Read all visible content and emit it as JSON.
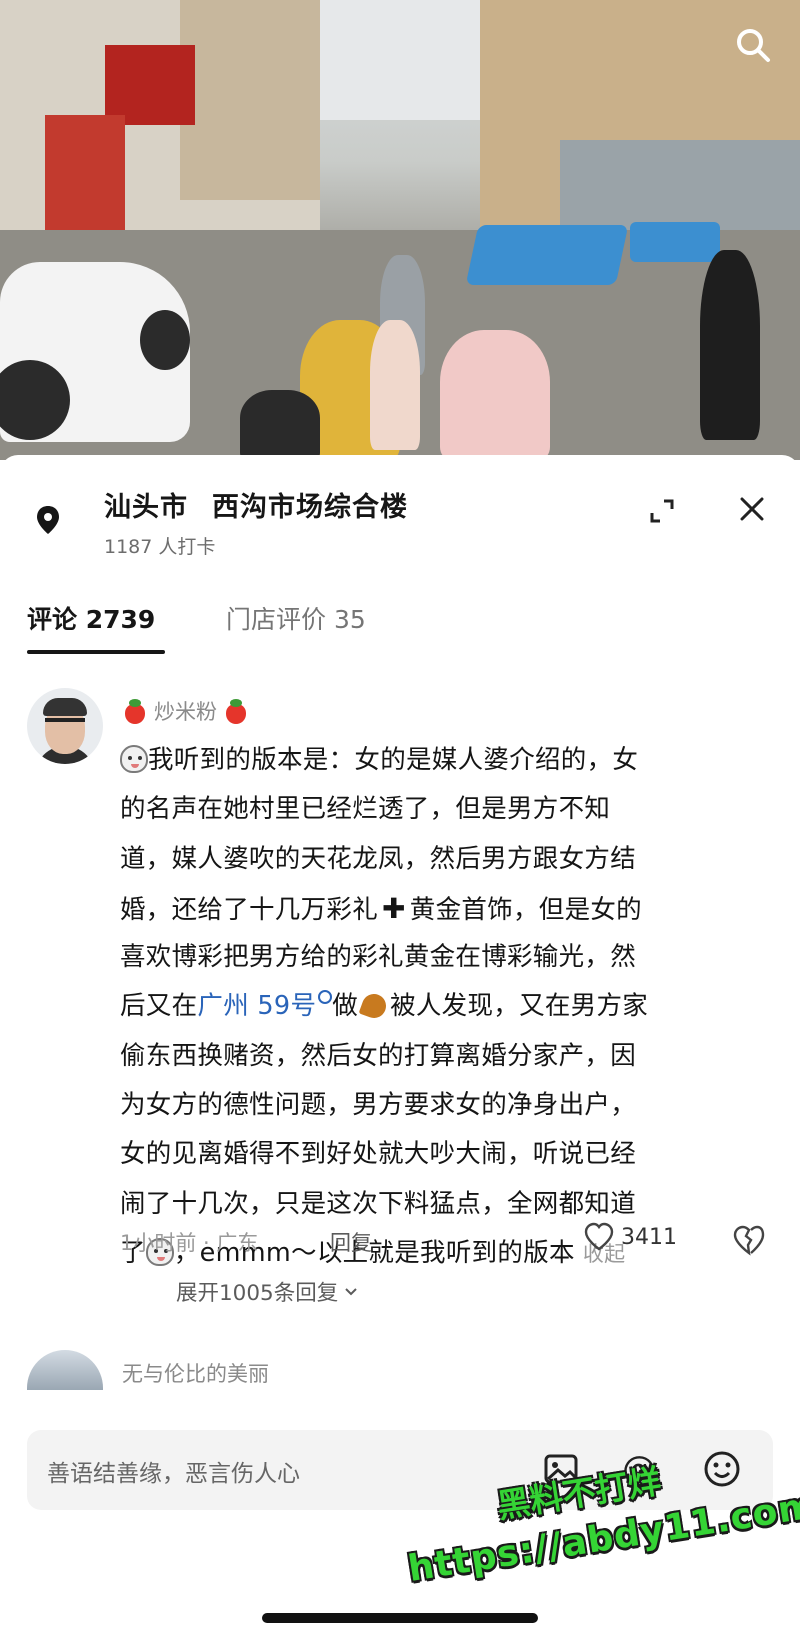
{
  "location": {
    "city": "汕头市",
    "place": "西沟市场综合楼",
    "checkins": "1187 人打卡"
  },
  "tabs": [
    {
      "label": "评论 2739",
      "active": true
    },
    {
      "label": "门店评价 35",
      "active": false
    }
  ],
  "comment": {
    "username": "炒米粉",
    "lines": [
      "我听到的版本是：女的是媒人婆介绍的，女",
      "的名声在她村里已经烂透了，但是男方不知",
      "道，媒人婆吹的天花龙凤，然后男方跟女方结",
      "婚，还给了十几万彩礼",
      "黄金首饰，但是女的",
      "喜欢博彩把男方给的彩礼黄金在博彩输光，然",
      "后又在",
      "广州 59号",
      "做",
      "被人发现，又在男方家",
      "偷东西换赌资，然后女的打算离婚分家产，因",
      "为女方的德性问题，男方要求女的净身出户，",
      "女的见离婚得不到好处就大吵大闹，听说已经",
      "闹了十几次，只是这次下料猛点，全网都知道",
      "了",
      "，emmm～以上就是我听到的版本"
    ],
    "collapse_label": "收起",
    "time_location": "1小时前 · 广东",
    "reply_label": "回复",
    "like_count": "3411",
    "expand_replies_label": "展开1005条回复"
  },
  "next_comment": {
    "username": "无与伦比的美丽"
  },
  "input": {
    "placeholder": "善语结善缘，恶言伤人心"
  },
  "watermark": {
    "line1": "黑料不打烊",
    "line2": "https://abdy11.com"
  },
  "colors": {
    "link": "#2a64b9",
    "watermark": "#35d435"
  },
  "icons": [
    "search-icon",
    "location-pin-icon",
    "expand-icon",
    "close-icon",
    "heart-icon",
    "broken-heart-icon",
    "image-icon",
    "at-icon",
    "emoji-icon"
  ]
}
